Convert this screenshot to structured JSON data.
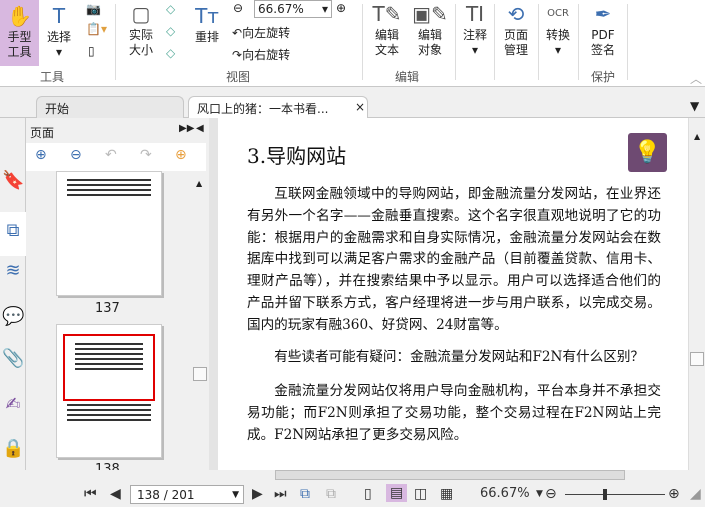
{
  "ribbon": {
    "hand_tool": "手型\n工具",
    "select": "选择",
    "actual_size": "实际\n大小",
    "reflow": "重排",
    "zoom_value": "66.67%",
    "rotate_left": "向左旋转",
    "rotate_right": "向右旋转",
    "edit_text": "编辑\n文本",
    "edit_object": "编辑\n对象",
    "comment": "注释",
    "page_manage": "页面\n管理",
    "convert": "转换",
    "pdf_sign": "PDF\n签名",
    "groups": {
      "tools": "工具",
      "view": "视图",
      "edit": "编辑",
      "protect": "保护"
    }
  },
  "tabs": [
    {
      "label": "开始"
    },
    {
      "label": "风口上的猪：一本书看..."
    }
  ],
  "panel": {
    "title": "页面",
    "thumbs": [
      {
        "page": "137"
      },
      {
        "page": "138"
      }
    ]
  },
  "document": {
    "heading": "3.导购网站",
    "paragraphs": [
      "互联网金融领域中的导购网站，即金融流量分发网站，在业界还有另外一个名字——金融垂直搜索。这个名字很直观地说明了它的功能：根据用户的金融需求和自身实际情况，金融流量分发网站会在数据库中找到可以满足客户需求的金融产品（目前覆盖贷款、信用卡、理财产品等），并在搜索结果中予以显示。用户可以选择适合他们的产品并留下联系方式，客户经理将进一步与用户联系，以完成交易。国内的玩家有融360、好贷网、24财富等。",
      "有些读者可能有疑问：金融流量分发网站和F2N有什么区别？",
      "金融流量分发网站仅将用户导向金融机构，平台本身并不承担交易功能；而F2N则承担了交易功能，整个交易过程在F2N网站上完成。F2N网站承担了更多交易风险。"
    ]
  },
  "status": {
    "page_field": "138 / 201",
    "zoom": "66.67%",
    "zoom_slider_fraction": 0.4
  },
  "colors": {
    "active_tool": "#d8b8e0",
    "tip_bg": "#6e4a72",
    "thumb_highlight": "#e00000"
  }
}
